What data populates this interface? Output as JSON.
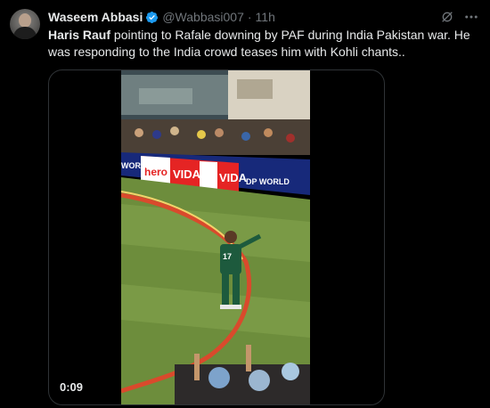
{
  "tweet": {
    "author_name": "Waseem Abbasi",
    "author_handle": "@Wabbasi007",
    "separator": "·",
    "time": "11h",
    "text_bold": "Haris Rauf",
    "text_rest": " pointing to Rafale downing by PAF during India Pakistan war. He was responding to the India crowd teases him with Kohli chants..",
    "video_duration": "0:09"
  },
  "video": {
    "board_words": [
      "hero",
      "VIDA",
      "DP WORLD",
      "WORLD"
    ],
    "jersey_number": "17"
  },
  "icons": {
    "verified": "verified-badge-icon",
    "grok": "grok-icon",
    "more": "more-icon"
  },
  "colors": {
    "accent": "#1d9bf0",
    "text": "#e7e9ea",
    "muted": "#71767b",
    "border": "#2f3336"
  }
}
